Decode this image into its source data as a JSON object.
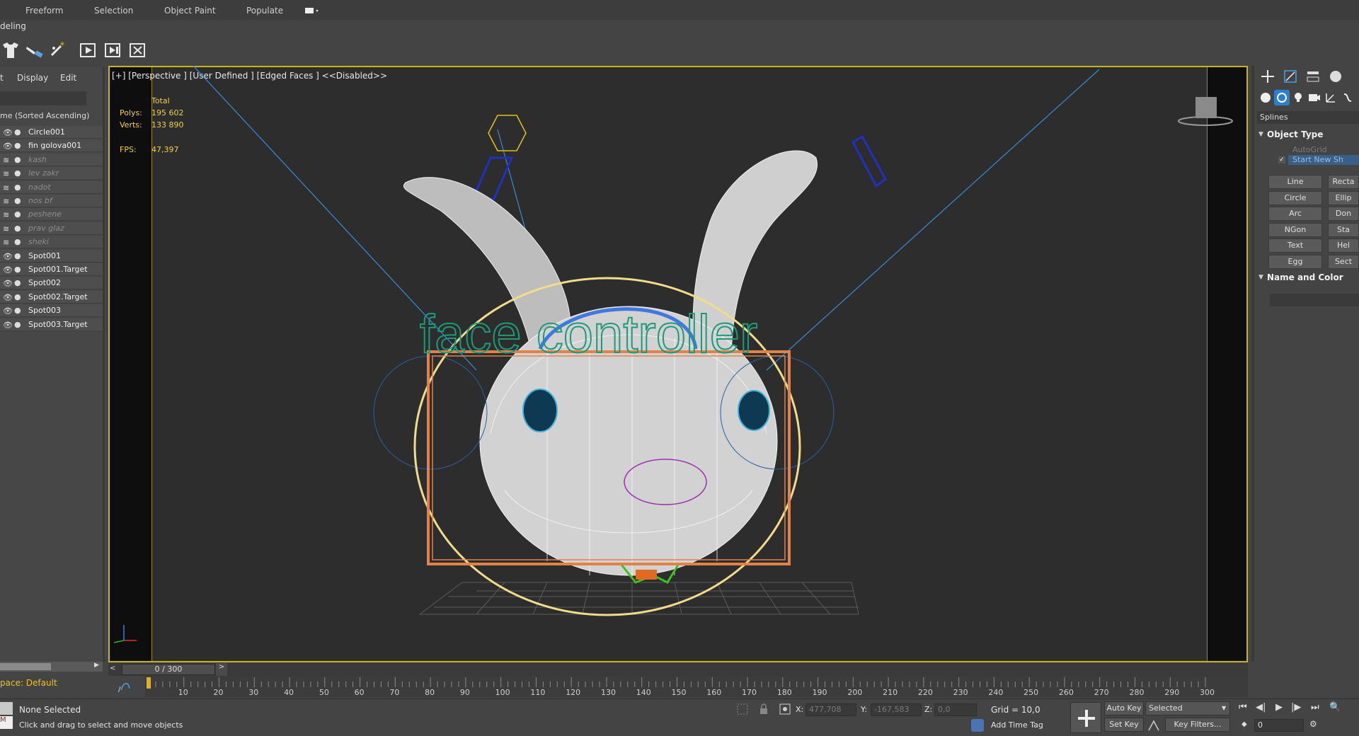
{
  "ribbon": {
    "tabs": [
      "Freeform",
      "Selection",
      "Object Paint",
      "Populate"
    ],
    "sub_label": "deling"
  },
  "explorer": {
    "menus": [
      "t",
      "Display",
      "Edit"
    ],
    "sort_header": "me (Sorted Ascending)",
    "rows": [
      {
        "name": "Circle001",
        "visible": true
      },
      {
        "name": "fin golova001",
        "visible": true
      },
      {
        "name": "kash",
        "visible": false
      },
      {
        "name": "lev zakr",
        "visible": false
      },
      {
        "name": "nadot",
        "visible": false
      },
      {
        "name": "nos bf",
        "visible": false
      },
      {
        "name": "peshene",
        "visible": false
      },
      {
        "name": "prav glaz",
        "visible": false
      },
      {
        "name": "sheki",
        "visible": false
      },
      {
        "name": "Spot001",
        "visible": true
      },
      {
        "name": "Spot001.Target",
        "visible": true
      },
      {
        "name": "Spot002",
        "visible": true
      },
      {
        "name": "Spot002.Target",
        "visible": true
      },
      {
        "name": "Spot003",
        "visible": true
      },
      {
        "name": "Spot003.Target",
        "visible": true
      }
    ],
    "workspace": "pace: Default"
  },
  "viewport": {
    "label": "[+] [Perspective ] [User Defined ] [Edged Faces ]  <<Disabled>>",
    "stats": {
      "total_label": "Total",
      "polys_label": "Polys:",
      "polys_value": "195 602",
      "verts_label": "Verts:",
      "verts_value": "133 890",
      "fps_label": "FPS:",
      "fps_value": "47,397"
    },
    "overlay_text": "face controller"
  },
  "command_panel": {
    "category": "Splines",
    "object_type_title": "Object Type",
    "autogrid": "AutoGrid",
    "start_new_shape": "Start New Sh",
    "buttons": [
      [
        "Line",
        "Recta"
      ],
      [
        "Circle",
        "Ellip"
      ],
      [
        "Arc",
        "Don"
      ],
      [
        "NGon",
        "Sta"
      ],
      [
        "Text",
        "Hel"
      ],
      [
        "Egg",
        "Sect"
      ]
    ],
    "name_color_title": "Name and Color"
  },
  "timeline": {
    "frame_display": "0 / 300",
    "ticks": [
      "10",
      "20",
      "30",
      "40",
      "50",
      "60",
      "70",
      "80",
      "90",
      "100",
      "110",
      "120",
      "130",
      "140",
      "150",
      "160",
      "170",
      "180",
      "190",
      "200",
      "210",
      "220",
      "230",
      "240",
      "250",
      "260",
      "270",
      "280",
      "290",
      "300"
    ]
  },
  "status": {
    "selection": "None Selected",
    "prompt": "Click and drag to select and move objects",
    "x_label": "X:",
    "x_value": "477,708",
    "y_label": "Y:",
    "y_value": "-167,583",
    "z_label": "Z:",
    "z_value": "0,0",
    "grid": "Grid = 10,0",
    "add_time_tag": "Add Time Tag",
    "auto_key": "Auto Key",
    "selected": "Selected",
    "set_key": "Set Key",
    "key_filters": "Key Filters...",
    "frame_field": "0"
  },
  "colors": {
    "viewport_border": "#c9b31e",
    "stats_text": "#f2d040",
    "controller_text": "#1e9a7a",
    "controller_box": "#e0834a"
  }
}
